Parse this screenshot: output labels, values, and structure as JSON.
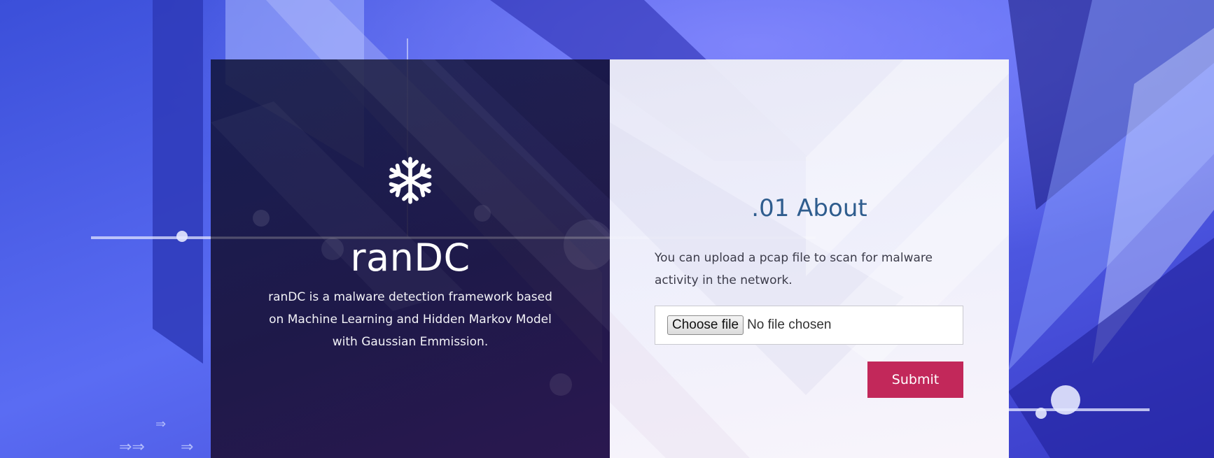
{
  "brand": {
    "icon": "snowflake-icon",
    "title": "ranDC",
    "description": "ranDC is a malware detection framework based on Machine Learning and Hidden Markov Model with Gaussian Emmission."
  },
  "about": {
    "title": ".01 About",
    "text": "You can upload a pcap file to scan for malware activity in the network."
  },
  "upload": {
    "choose_label": "Choose file",
    "status": "No file chosen"
  },
  "submit_label": "Submit",
  "colors": {
    "background": "#3f55e6",
    "accent": "#c2285a",
    "about_title": "#2f5d8e",
    "left_panel": "#141436",
    "right_panel": "#f0f0f8"
  }
}
